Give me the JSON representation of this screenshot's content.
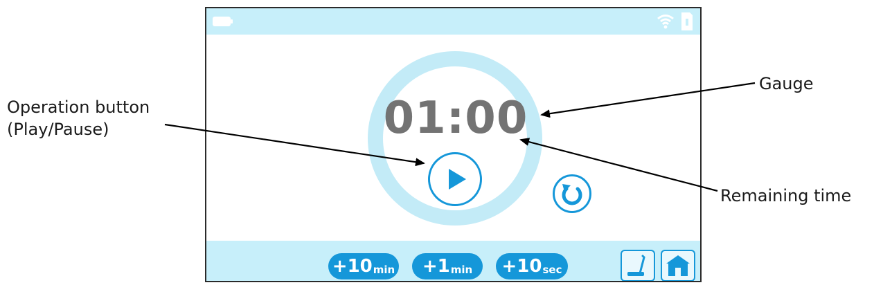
{
  "labels": {
    "operation_line1": "Operation button",
    "operation_line2": "(Play/Pause)",
    "gauge": "Gauge",
    "remaining": "Remaining time"
  },
  "timer": {
    "remaining_time": "01:00"
  },
  "buttons": {
    "add_10min": {
      "value": "+10",
      "unit": "min"
    },
    "add_1min": {
      "value": "+1",
      "unit": "min"
    },
    "add_10sec": {
      "value": "+10",
      "unit": "sec"
    }
  },
  "icons": {
    "battery": "battery-icon",
    "wifi": "wifi-icon",
    "sd": "memory-card-icon",
    "play": "play-icon",
    "reset": "reset-icon",
    "scale": "scale-icon",
    "home": "home-icon"
  },
  "colors": {
    "bar": "#c7effa",
    "accent": "#1597d9",
    "gauge": "#c3ebf7",
    "time_text": "#737373"
  }
}
